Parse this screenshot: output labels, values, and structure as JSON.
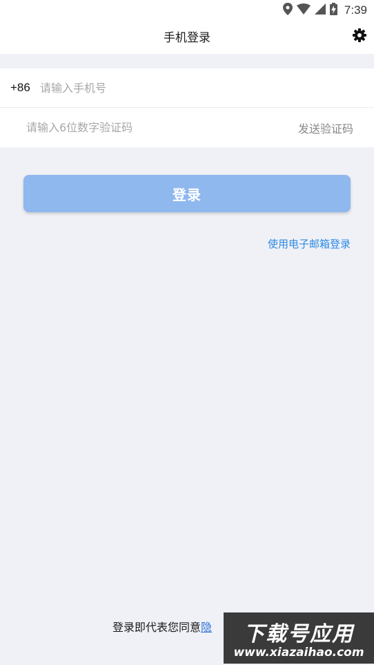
{
  "status_bar": {
    "time": "7:39",
    "icons": [
      "location-icon",
      "wifi-icon",
      "signal-icon",
      "battery-charging-icon"
    ]
  },
  "header": {
    "title": "手机登录",
    "settings_icon": "gear-icon"
  },
  "form": {
    "country_code": "+86",
    "phone_placeholder": "请输入手机号",
    "phone_value": "",
    "code_placeholder": "请输入6位数字验证码",
    "code_value": "",
    "send_code_label": "发送验证码"
  },
  "login_button": {
    "label": "登录"
  },
  "email_login_link": "使用电子邮箱登录",
  "agreement": {
    "prefix": "登录即代表您同意",
    "privacy_link": "隐"
  },
  "watermark": {
    "main": "下载号应用",
    "url": "www.xiazaihao.com"
  },
  "colors": {
    "background": "#f0f1f6",
    "login_button": "#8fb8ee",
    "link": "#2d8ae6"
  }
}
